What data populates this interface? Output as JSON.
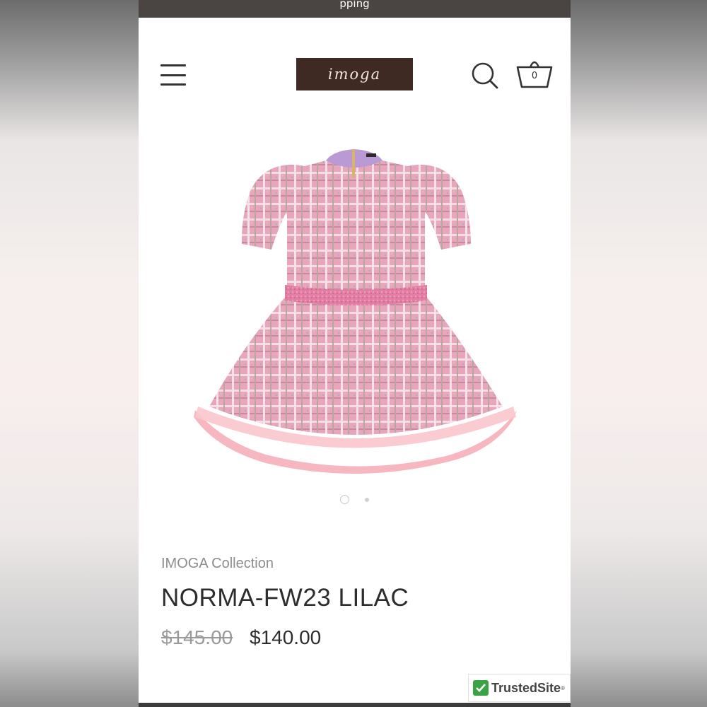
{
  "announcement": {
    "text": "pping"
  },
  "header": {
    "menu_icon": "hamburger-icon",
    "logo_text": "imoga",
    "search_icon": "search-icon",
    "cart_icon": "basket-icon",
    "cart_count": "0"
  },
  "gallery": {
    "image_alt": "Pink tweed dress with pink tulle underskirt",
    "dots": [
      "slide-1",
      "slide-2"
    ],
    "active_index": 0
  },
  "product": {
    "vendor": "IMOGA Collection",
    "title": "NORMA-FW23 LILAC",
    "compare_price": "$145.00",
    "price": "$140.00"
  },
  "badge": {
    "label": "TrustedSite",
    "mark": "®"
  },
  "colors": {
    "announcement_bg": "#4a4543",
    "logo_bg": "#3e2a23",
    "dress_pink": "#e8a9bd",
    "tulle_pink": "#f7b7c0",
    "trusted_green": "#3aa344"
  }
}
